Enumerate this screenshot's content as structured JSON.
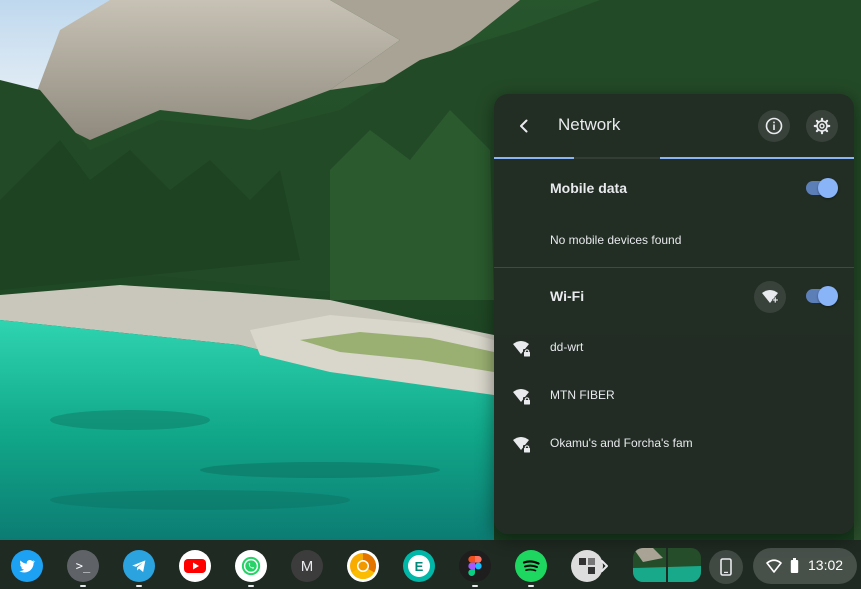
{
  "network_panel": {
    "title": "Network",
    "mobile_data": {
      "title": "Mobile data",
      "enabled": true,
      "status": "No mobile devices found"
    },
    "wifi": {
      "title": "Wi-Fi",
      "enabled": true,
      "networks": [
        {
          "name": "dd-wrt",
          "secured": true
        },
        {
          "name": "MTN FIBER",
          "secured": true
        },
        {
          "name": "Okamu's and Forcha's fam",
          "secured": true
        }
      ]
    },
    "icons": {
      "back": "back-arrow-icon",
      "info": "info-icon",
      "settings": "gear-icon",
      "add_wifi": "add-wifi-icon",
      "network": "wifi-lock-icon"
    }
  },
  "shelf": {
    "apps": [
      {
        "name": "Twitter",
        "icon": "twitter-icon",
        "color": "#1da1f2",
        "running": false
      },
      {
        "name": "Terminal",
        "icon": "terminal-icon",
        "color": "#5f6368",
        "running": true
      },
      {
        "name": "Telegram",
        "icon": "telegram-icon",
        "color": "#2aa3df",
        "running": true
      },
      {
        "name": "YouTube",
        "icon": "youtube-icon",
        "color": "#ff0000",
        "running": false
      },
      {
        "name": "WhatsApp",
        "icon": "whatsapp-icon",
        "color": "#25d366",
        "running": true
      },
      {
        "name": "M",
        "icon": "m-letter-icon",
        "color": "#3c3c3c",
        "running": false
      },
      {
        "name": "Chrome Canary",
        "icon": "chrome-canary-icon",
        "color": "#f9ab00",
        "running": false
      },
      {
        "name": "E",
        "icon": "e-letter-icon",
        "color": "#00b7a8",
        "running": false
      },
      {
        "name": "Figma",
        "icon": "figma-icon",
        "color": "#1e1e1e",
        "running": true
      },
      {
        "name": "Spotify",
        "icon": "spotify-icon",
        "color": "#1ed760",
        "running": true
      },
      {
        "name": "App",
        "icon": "app-icon",
        "color": "#dddddd",
        "running": false
      }
    ],
    "letters": {
      "m_app": "M",
      "e_app": "E",
      "terminal": ">_"
    },
    "overflow_icon": "chevron-right-icon",
    "status_area": {
      "time": "13:02",
      "wifi_icon": "wifi-icon",
      "battery_icon": "battery-icon"
    },
    "holding_space_icon": "phone-icon",
    "desks_icon": "desks-thumbnail"
  },
  "colors": {
    "accent": "#8ab4f8",
    "panel_bg": "#222c24",
    "text": "#e8eaed"
  }
}
